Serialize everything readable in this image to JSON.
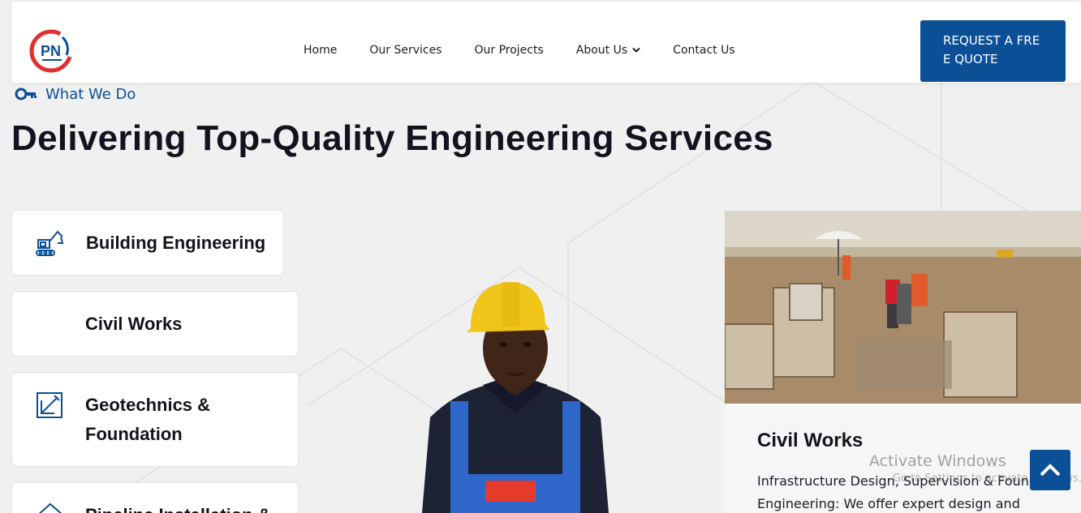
{
  "brand": {
    "accent": "#0b4f96",
    "logo_text": "PN",
    "logo_red": "#e03131"
  },
  "nav": {
    "items": [
      {
        "label": "Home"
      },
      {
        "label": "Our Services"
      },
      {
        "label": "Our Projects"
      },
      {
        "label": "About Us"
      },
      {
        "label": "Contact Us"
      }
    ],
    "cta_label": "REQUEST A FREE QUOTE"
  },
  "section": {
    "eyebrow": "What We Do",
    "title": "Delivering Top-Quality Engineering Services"
  },
  "services": [
    {
      "label": "Building Engineering",
      "icon": "excavator-icon"
    },
    {
      "label": "Civil Works",
      "icon": ""
    },
    {
      "label": "Geotechnics & Foundation",
      "icon": "blueprint-icon"
    },
    {
      "label": "Pipeline Installation &",
      "icon": "house-icon"
    }
  ],
  "project": {
    "title": "Civil Works",
    "description": "Infrastructure Design, Supervision & Foundation Engineering: We offer expert design and"
  },
  "overlay": {
    "activate_title": "Activate Windows",
    "activate_sub": "Go to Settings to activate Windows."
  }
}
